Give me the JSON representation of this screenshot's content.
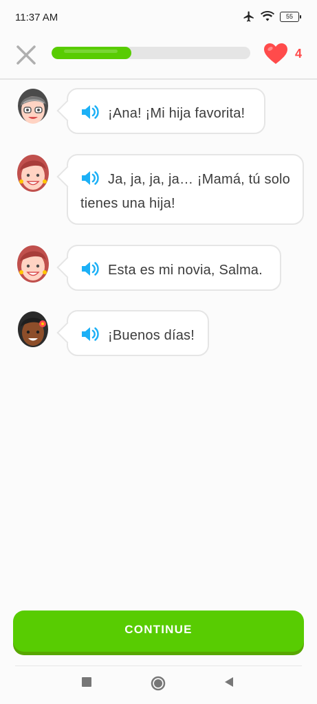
{
  "status_bar": {
    "time": "11:37 AM",
    "battery": "55"
  },
  "header": {
    "progress_fraction": 0.4,
    "hearts_count": "4"
  },
  "colors": {
    "accent": "#58cc02",
    "accent_shadow": "#58a700",
    "heart": "#ff4b4b",
    "speaker": "#1cb0f6"
  },
  "messages": [
    {
      "speaker": "grandmother",
      "text": "¡Ana! ¡Mi hija favorita!"
    },
    {
      "speaker": "ana",
      "text": "Ja, ja, ja, ja… ¡Mamá, tú solo tienes una hija!"
    },
    {
      "speaker": "ana",
      "text": "Esta es mi novia, Salma."
    },
    {
      "speaker": "salma",
      "text": "¡Buenos días!"
    }
  ],
  "footer": {
    "continue_label": "CONTINUE"
  },
  "icons": [
    "close-icon",
    "heart-icon",
    "speaker-icon",
    "square-nav-icon",
    "circle-nav-icon",
    "back-nav-icon"
  ]
}
